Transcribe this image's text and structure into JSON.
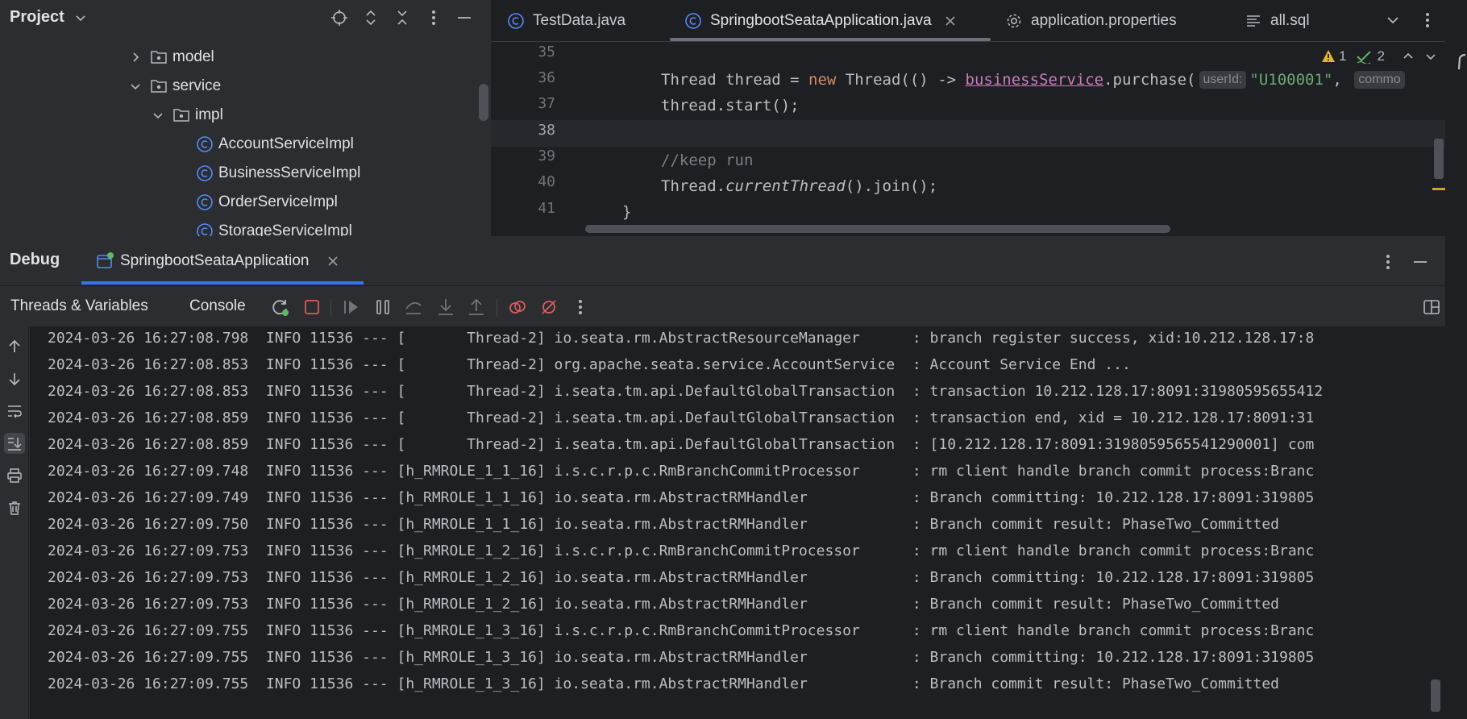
{
  "project": {
    "title": "Project",
    "tree": [
      {
        "label": "model",
        "type": "folder",
        "expanded": false
      },
      {
        "label": "service",
        "type": "folder",
        "expanded": true
      },
      {
        "label": "impl",
        "type": "folder",
        "expanded": true
      },
      {
        "label": "AccountServiceImpl",
        "type": "class"
      },
      {
        "label": "BusinessServiceImpl",
        "type": "class"
      },
      {
        "label": "OrderServiceImpl",
        "type": "class"
      },
      {
        "label": "StorageServiceImpl",
        "type": "class"
      }
    ]
  },
  "editor": {
    "tabs": [
      {
        "label": "TestData.java",
        "icon": "java-class-icon",
        "active": false
      },
      {
        "label": "SpringbootSeataApplication.java",
        "icon": "java-class-icon",
        "active": true,
        "closable": true
      },
      {
        "label": "application.properties",
        "icon": "gear-icon",
        "active": false
      },
      {
        "label": "all.sql",
        "icon": "sql-icon",
        "active": false
      }
    ],
    "inspections": {
      "warnings": "1",
      "ok": "2"
    },
    "line_numbers": [
      "35",
      "36",
      "37",
      "38",
      "39",
      "40",
      "41"
    ],
    "current_line": "38",
    "code": {
      "l36_a": "Thread thread = ",
      "l36_kw": "new",
      "l36_b": " Thread(() -> ",
      "l36_field": "businessService",
      "l36_c": ".purchase(",
      "l36_hint1": "userId:",
      "l36_str": "\"U100001\"",
      "l36_d": ", ",
      "l36_hint2": "commo",
      "l37": "thread.start();",
      "l39": "//keep run",
      "l40_a": "Thread.",
      "l40_itl": "currentThread",
      "l40_b": "().join();",
      "l41": "}"
    }
  },
  "debug": {
    "title": "Debug",
    "session_tab": "SpringbootSeataApplication",
    "tabs": [
      "Threads & Variables",
      "Console"
    ],
    "log": [
      "2024-03-26 16:27:08.798  INFO 11536 --- [       Thread-2] io.seata.rm.AbstractResourceManager      : branch register success, xid:10.212.128.17:8",
      "2024-03-26 16:27:08.853  INFO 11536 --- [       Thread-2] org.apache.seata.service.AccountService  : Account Service End ...",
      "2024-03-26 16:27:08.853  INFO 11536 --- [       Thread-2] i.seata.tm.api.DefaultGlobalTransaction  : transaction 10.212.128.17:8091:31980595655412",
      "2024-03-26 16:27:08.859  INFO 11536 --- [       Thread-2] i.seata.tm.api.DefaultGlobalTransaction  : transaction end, xid = 10.212.128.17:8091:31",
      "2024-03-26 16:27:08.859  INFO 11536 --- [       Thread-2] i.seata.tm.api.DefaultGlobalTransaction  : [10.212.128.17:8091:3198059565541290001] com",
      "2024-03-26 16:27:09.748  INFO 11536 --- [h_RMROLE_1_1_16] i.s.c.r.p.c.RmBranchCommitProcessor      : rm client handle branch commit process:Branc",
      "2024-03-26 16:27:09.749  INFO 11536 --- [h_RMROLE_1_1_16] io.seata.rm.AbstractRMHandler            : Branch committing: 10.212.128.17:8091:319805",
      "2024-03-26 16:27:09.750  INFO 11536 --- [h_RMROLE_1_1_16] io.seata.rm.AbstractRMHandler            : Branch commit result: PhaseTwo_Committed",
      "2024-03-26 16:27:09.753  INFO 11536 --- [h_RMROLE_1_2_16] i.s.c.r.p.c.RmBranchCommitProcessor      : rm client handle branch commit process:Branc",
      "2024-03-26 16:27:09.753  INFO 11536 --- [h_RMROLE_1_2_16] io.seata.rm.AbstractRMHandler            : Branch committing: 10.212.128.17:8091:319805",
      "2024-03-26 16:27:09.753  INFO 11536 --- [h_RMROLE_1_2_16] io.seata.rm.AbstractRMHandler            : Branch commit result: PhaseTwo_Committed",
      "2024-03-26 16:27:09.755  INFO 11536 --- [h_RMROLE_1_3_16] i.s.c.r.p.c.RmBranchCommitProcessor      : rm client handle branch commit process:Branc",
      "2024-03-26 16:27:09.755  INFO 11536 --- [h_RMROLE_1_3_16] io.seata.rm.AbstractRMHandler            : Branch committing: 10.212.128.17:8091:319805",
      "2024-03-26 16:27:09.755  INFO 11536 --- [h_RMROLE_1_3_16] io.seata.rm.AbstractRMHandler            : Branch commit result: PhaseTwo_Committed"
    ]
  },
  "colors": {
    "accent": "#3574f0",
    "stop_red": "#db5c5c",
    "class_icon_blue": "#548af7",
    "rerun_green": "#5fb865"
  }
}
